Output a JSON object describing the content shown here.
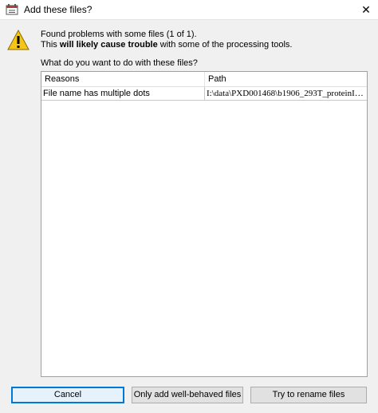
{
  "window": {
    "title": "Add these files?",
    "close_glyph": "✕"
  },
  "message": {
    "line1": "Found problems with some files (1 of 1).",
    "line2_prefix": "This ",
    "line2_bold": "will likely cause trouble",
    "line2_suffix": " with some of the processing tools.",
    "question": "What do you want to do with these files?"
  },
  "table": {
    "columns": [
      "Reasons",
      "Path"
    ],
    "rows": [
      {
        "reason": "File name has multiple dots",
        "path": "I:\\data\\PXD001468\\b1906_293T_proteinID..."
      }
    ]
  },
  "buttons": {
    "cancel": "Cancel",
    "well_behaved": "Only add well-behaved files",
    "rename": "Try to rename files"
  },
  "colors": {
    "focus_border": "#0078d7",
    "warning_yellow": "#f5c518"
  }
}
